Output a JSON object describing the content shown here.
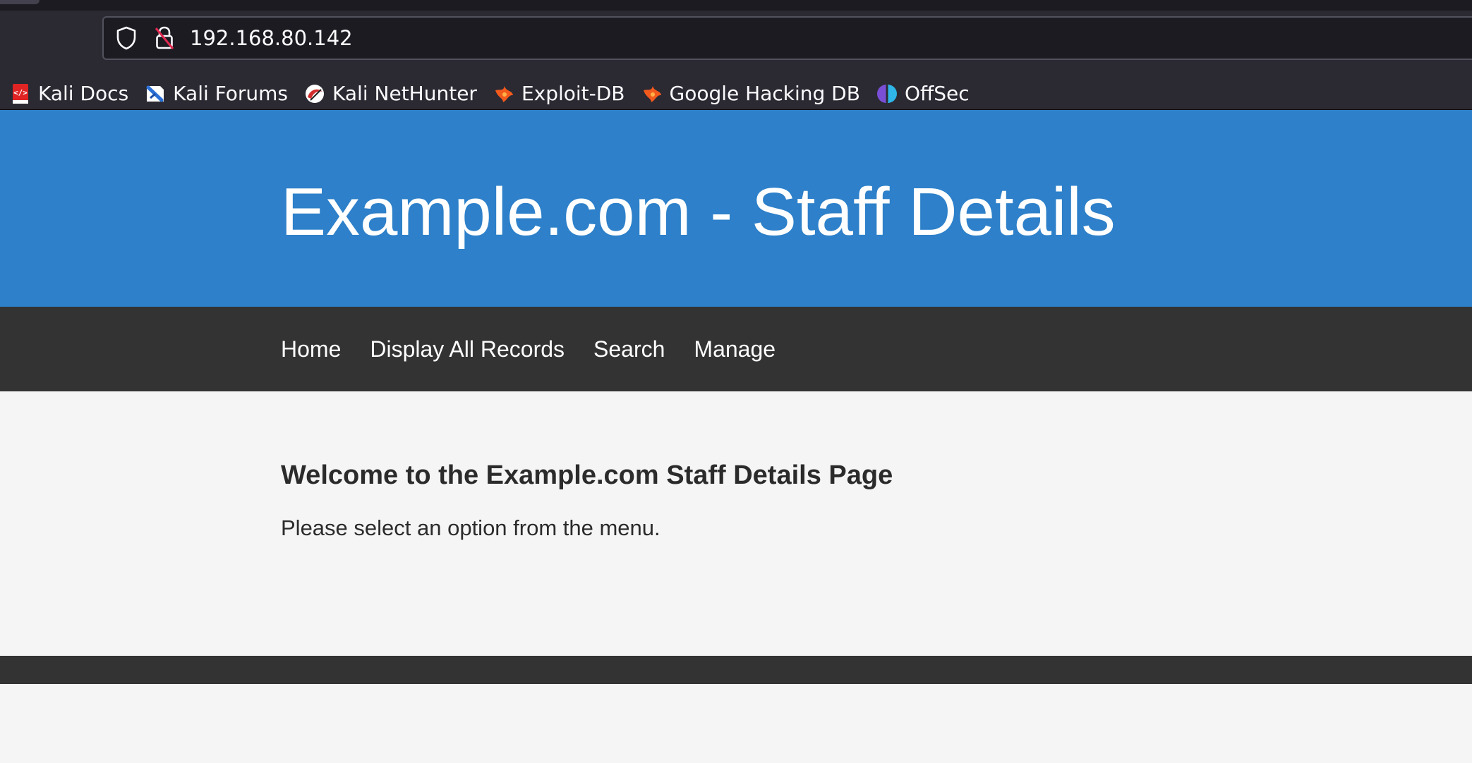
{
  "browser": {
    "url": "192.168.80.142",
    "icons": {
      "tracking_protection": "shield-icon",
      "connection_status": "insecure-lock-icon"
    },
    "bookmarks": [
      {
        "label": "Kali Docs",
        "icon": "kali-docs-icon"
      },
      {
        "label": "Kali Forums",
        "icon": "kali-forums-icon"
      },
      {
        "label": "Kali NetHunter",
        "icon": "kali-nethunter-icon"
      },
      {
        "label": "Exploit-DB",
        "icon": "exploit-db-icon"
      },
      {
        "label": "Google Hacking DB",
        "icon": "google-hacking-db-icon"
      },
      {
        "label": "OffSec",
        "icon": "offsec-icon"
      }
    ]
  },
  "page": {
    "title": "Example.com - Staff Details",
    "nav": [
      {
        "label": "Home"
      },
      {
        "label": "Display All Records"
      },
      {
        "label": "Search"
      },
      {
        "label": "Manage"
      }
    ],
    "heading": "Welcome to the Example.com Staff Details Page",
    "message": "Please select an option from the menu."
  },
  "colors": {
    "header_background": "#2d80c9",
    "nav_background": "#333333",
    "page_background": "#f5f5f5",
    "browser_toolbar": "#2b2a33"
  }
}
